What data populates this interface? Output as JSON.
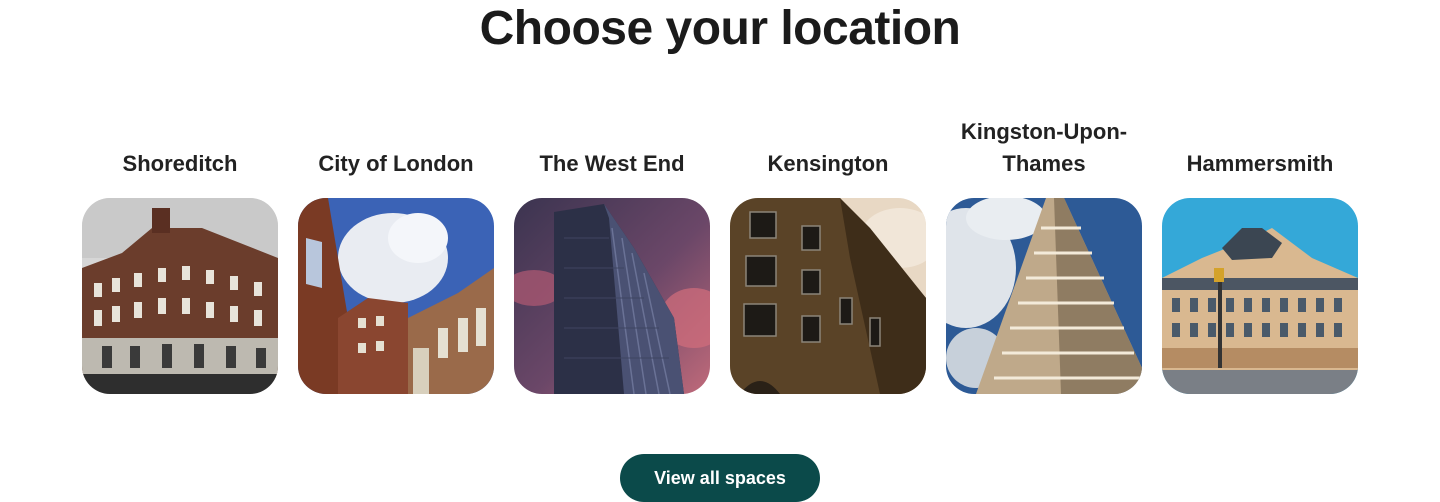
{
  "heading": "Choose your location",
  "locations": [
    {
      "name": "Shoreditch",
      "image": "red-brick-corner-building-photo"
    },
    {
      "name": "City of London",
      "image": "brick-courtyard-sky-photo"
    },
    {
      "name": "The West End",
      "image": "dark-tower-pink-sky-photo"
    },
    {
      "name": "Kensington",
      "image": "warehouse-brick-building-photo"
    },
    {
      "name": "Kingston-Upon-Thames",
      "image": "concrete-highrise-photo"
    },
    {
      "name": "Hammersmith",
      "image": "beige-hotel-building-photo"
    }
  ],
  "cta": {
    "label": "View all spaces"
  },
  "colors": {
    "cta_background": "#0b4a4a",
    "cta_text": "#ffffff",
    "heading": "#1b1b1b"
  }
}
